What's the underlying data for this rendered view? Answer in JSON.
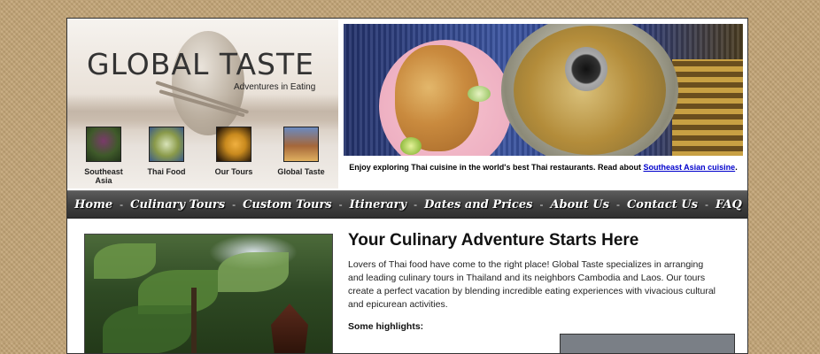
{
  "site": {
    "logo_title": "GLOBAL TASTE",
    "logo_tagline": "Adventures in Eating"
  },
  "thumbnails": [
    {
      "label": "Southeast Asia",
      "color": "#3f5a2a"
    },
    {
      "label": "Thai Food",
      "color": "#8a9a4a"
    },
    {
      "label": "Our Tours",
      "color": "#c98a1e"
    },
    {
      "label": "Global Taste",
      "color": "#a5673a"
    }
  ],
  "caption": {
    "text": "Enjoy exploring Thai cuisine in the world's best Thai restaurants. Read about ",
    "link": "Southeast Asian cuisine",
    "suffix": "."
  },
  "nav": [
    "Home",
    "Culinary Tours",
    "Custom Tours",
    "Itinerary",
    "Dates and Prices",
    "About Us",
    "Contact Us",
    "FAQ"
  ],
  "nav_separator": "-",
  "main": {
    "title": "Your Culinary Adventure Starts Here",
    "intro": "Lovers of Thai food have come to the right place! Global Taste specializes in arranging and leading culinary tours in Thailand and its neighbors Cambodia and Laos. Our tours create a perfect vacation by blending incredible eating experiences with vivacious cultural and epicurean activities.",
    "highlights_heading": "Some highlights:"
  },
  "colors": {
    "background": "#c3a476",
    "nav_bar": "#404040",
    "link": "#0000cc"
  }
}
